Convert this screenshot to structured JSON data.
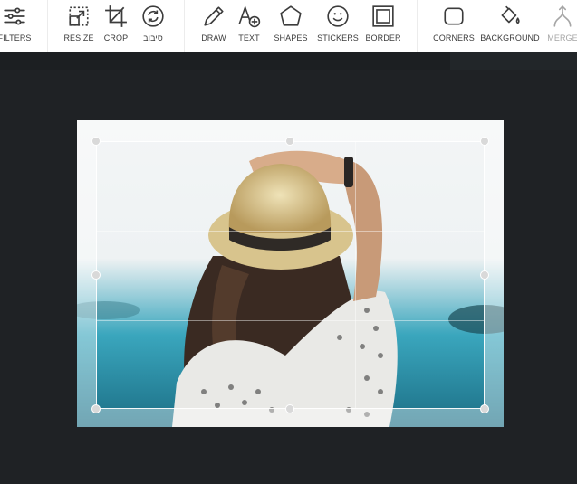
{
  "toolbar": {
    "tools": [
      {
        "id": "filters",
        "label": "FILTERS",
        "icon": "sliders-icon",
        "enabled": true
      },
      {
        "id": "resize",
        "label": "RESIZE",
        "icon": "resize-icon",
        "enabled": true
      },
      {
        "id": "crop",
        "label": "CROP",
        "icon": "crop-icon",
        "enabled": true
      },
      {
        "id": "rotate",
        "label": "סיבוב",
        "icon": "rotate-icon",
        "enabled": true
      },
      {
        "id": "draw",
        "label": "DRAW",
        "icon": "pencil-icon",
        "enabled": true
      },
      {
        "id": "text",
        "label": "TEXT",
        "icon": "text-add-icon",
        "enabled": true
      },
      {
        "id": "shapes",
        "label": "SHAPES",
        "icon": "pentagon-icon",
        "enabled": true
      },
      {
        "id": "stickers",
        "label": "STICKERS",
        "icon": "smiley-icon",
        "enabled": true
      },
      {
        "id": "border",
        "label": "BORDER",
        "icon": "border-frame-icon",
        "enabled": true
      },
      {
        "id": "corners",
        "label": "CORNERS",
        "icon": "rounded-square-icon",
        "enabled": true
      },
      {
        "id": "background",
        "label": "BACKGROUND",
        "icon": "paint-bucket-icon",
        "enabled": true
      },
      {
        "id": "merge",
        "label": "MERGE",
        "icon": "merge-icon",
        "enabled": false
      }
    ]
  },
  "colors": {
    "toolbar_bg": "#ffffff",
    "workspace_bg": "#1f2225",
    "icon_color": "#3c3c3c",
    "disabled_color": "#a6a6a6",
    "crop_handle": "#d9d9d9"
  },
  "image": {
    "description_icon": "photo-canvas"
  }
}
